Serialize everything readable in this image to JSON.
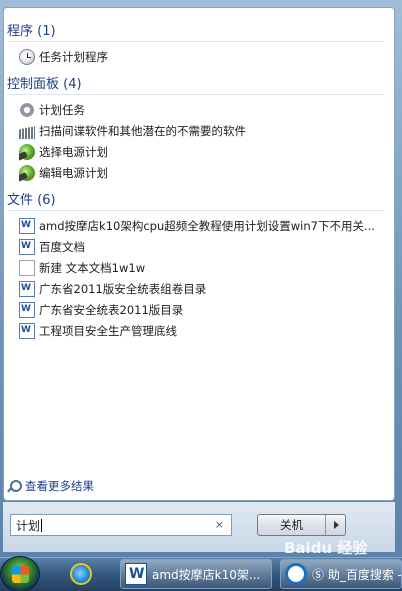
{
  "start_menu": {
    "groups": [
      {
        "header": "程序 (1)",
        "items": [
          {
            "label": "任务计划程序",
            "icon": "clock-icon"
          }
        ]
      },
      {
        "header": "控制面板 (4)",
        "items": [
          {
            "label": "计划任务",
            "icon": "scheduled-task-icon"
          },
          {
            "label": "扫描间谍软件和其他潜在的不需要的软件",
            "icon": "defender-scan-icon"
          },
          {
            "label": "选择电源计划",
            "icon": "power-plan-icon"
          },
          {
            "label": "编辑电源计划",
            "icon": "power-plan-icon"
          }
        ]
      },
      {
        "header": "文件 (6)",
        "items": [
          {
            "label": "amd按摩店k10架构cpu超频全教程使用计划设置win7下不用关...",
            "icon": "word-document-icon"
          },
          {
            "label": "百度文档",
            "icon": "word-document-icon"
          },
          {
            "label": "新建 文本文档1w1w",
            "icon": "text-document-icon"
          },
          {
            "label": "广东省2011版安全统表组卷目录",
            "icon": "word-document-icon"
          },
          {
            "label": "广东省安全统表2011版目录",
            "icon": "word-document-icon"
          },
          {
            "label": "工程项目安全生产管理底线",
            "icon": "word-document-icon"
          }
        ]
      }
    ],
    "see_more": "查看更多结果",
    "search": {
      "value": "计划",
      "clear_icon": "×"
    },
    "shutdown_label": "关机"
  },
  "taskbar": {
    "word_task": "amd按摩店k10架...",
    "browser_task": "Ⓢ 助_百度搜索 - c",
    "watermark": "Baidu 经验"
  }
}
